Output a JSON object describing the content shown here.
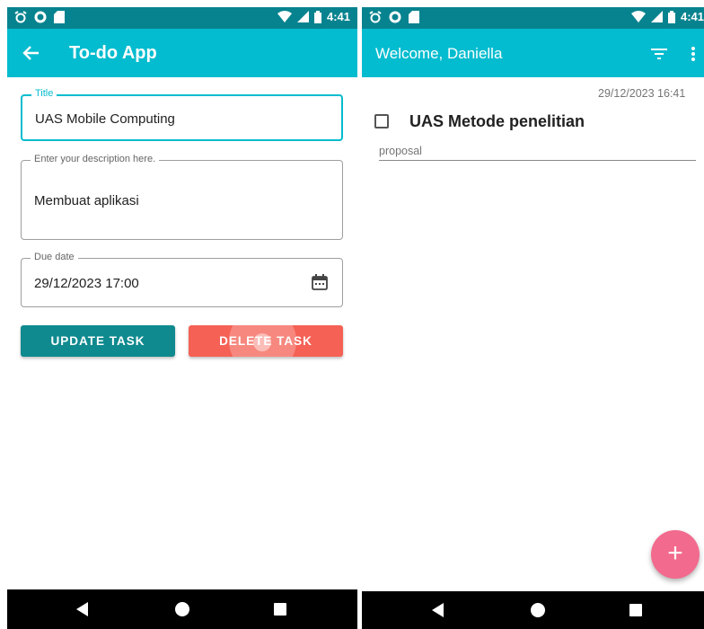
{
  "colors": {
    "status_bar": "#07838f",
    "app_bar": "#04bccf",
    "update_button": "#0f8a8f",
    "delete_button": "#f56155",
    "fab": "#f26a8d"
  },
  "left": {
    "status": {
      "time": "4:41"
    },
    "app_title": "To-do App",
    "form": {
      "title_label": "Title",
      "title_value": "UAS Mobile Computing",
      "description_label": "Enter your description here.",
      "description_value": "Membuat aplikasi",
      "due_label": "Due date",
      "due_value": "29/12/2023 17:00"
    },
    "buttons": {
      "update": "UPDATE TASK",
      "delete": "DELETE TASK"
    }
  },
  "right": {
    "status": {
      "time": "4:41"
    },
    "app_title": "Welcome, Daniella",
    "task": {
      "timestamp": "29/12/2023 16:41",
      "title": "UAS Metode penelitian",
      "category": "proposal",
      "checked": false
    },
    "fab_label": "+"
  },
  "icons": {
    "back": "arrow-left-icon",
    "filter": "filter-icon",
    "more": "more-vert-icon",
    "calendar": "calendar-icon"
  }
}
